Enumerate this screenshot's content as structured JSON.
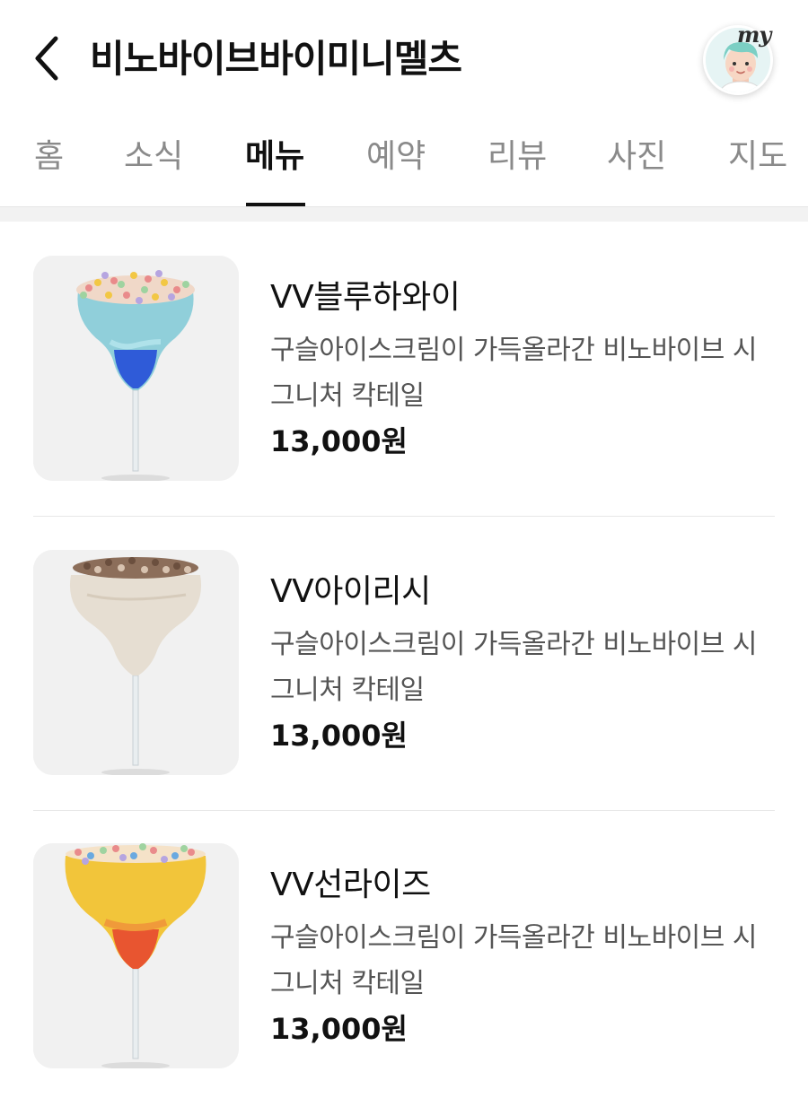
{
  "header": {
    "title": "비노바이브바이미니멜츠",
    "back_icon": "chevron-left-icon",
    "avatar_badge": "my"
  },
  "tabs": [
    {
      "label": "홈",
      "active": false
    },
    {
      "label": "소식",
      "active": false
    },
    {
      "label": "메뉴",
      "active": true
    },
    {
      "label": "예약",
      "active": false
    },
    {
      "label": "리뷰",
      "active": false
    },
    {
      "label": "사진",
      "active": false
    },
    {
      "label": "지도",
      "active": false
    }
  ],
  "menu": {
    "items": [
      {
        "name": "VV블루하와이",
        "description": "구슬아이스크림이 가득올라간 비노바이브 시그니처 칵테일",
        "price": "13,000원",
        "image": "blue-cocktail-icon"
      },
      {
        "name": "VV아이리시",
        "description": "구슬아이스크림이 가득올라간 비노바이브 시그니처 칵테일",
        "price": "13,000원",
        "image": "cream-cocktail-icon"
      },
      {
        "name": "VV선라이즈",
        "description": "구슬아이스크림이 가득올라간 비노바이브 시그니처 칵테일",
        "price": "13,000원",
        "image": "sunrise-cocktail-icon"
      }
    ]
  },
  "colors": {
    "text_primary": "#111111",
    "text_secondary": "#555555",
    "tab_inactive": "#8a8a8a",
    "thumb_bg": "#f1f1f1",
    "divider": "#f2f2f2"
  }
}
